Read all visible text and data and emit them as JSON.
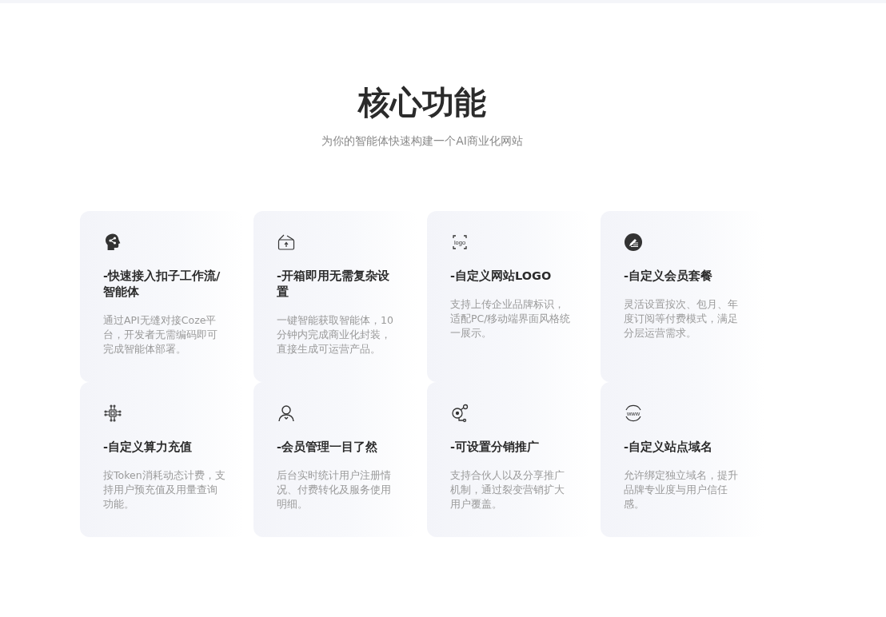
{
  "section": {
    "title": "核心功能",
    "subtitle": "为你的智能体快速构建一个AI商业化网站"
  },
  "features": [
    {
      "title": "-快速接入扣子工作流/智能体",
      "description": "通过API无缝对接Coze平台，开发者无需编码即可完成智能体部署。"
    },
    {
      "title": "-开箱即用无需复杂设置",
      "description": "一键智能获取智能体，10分钟内完成商业化封装，直接生成可运营产品。"
    },
    {
      "icon_text": "logo",
      "title": "-自定义网站LOGO",
      "description": "支持上传企业品牌标识，适配PC/移动端界面风格统一展示。"
    },
    {
      "title": "-自定义会员套餐",
      "description": "灵活设置按次、包月、年度订阅等付费模式，满足分层运营需求。"
    },
    {
      "title": "-自定义算力充值",
      "description": "按Token消耗动态计费，支持用户预充值及用量查询功能。"
    },
    {
      "title": "-会员管理一目了然",
      "description": "后台实时统计用户注册情况、付费转化及服务使用明细。"
    },
    {
      "title": "-可设置分销推广",
      "description": "支持合伙人以及分享推广机制，通过裂变营销扩大用户覆盖。"
    },
    {
      "icon_text": "www",
      "title": "-自定义站点域名",
      "description": "允许绑定独立域名，提升品牌专业度与用户信任感。"
    }
  ]
}
